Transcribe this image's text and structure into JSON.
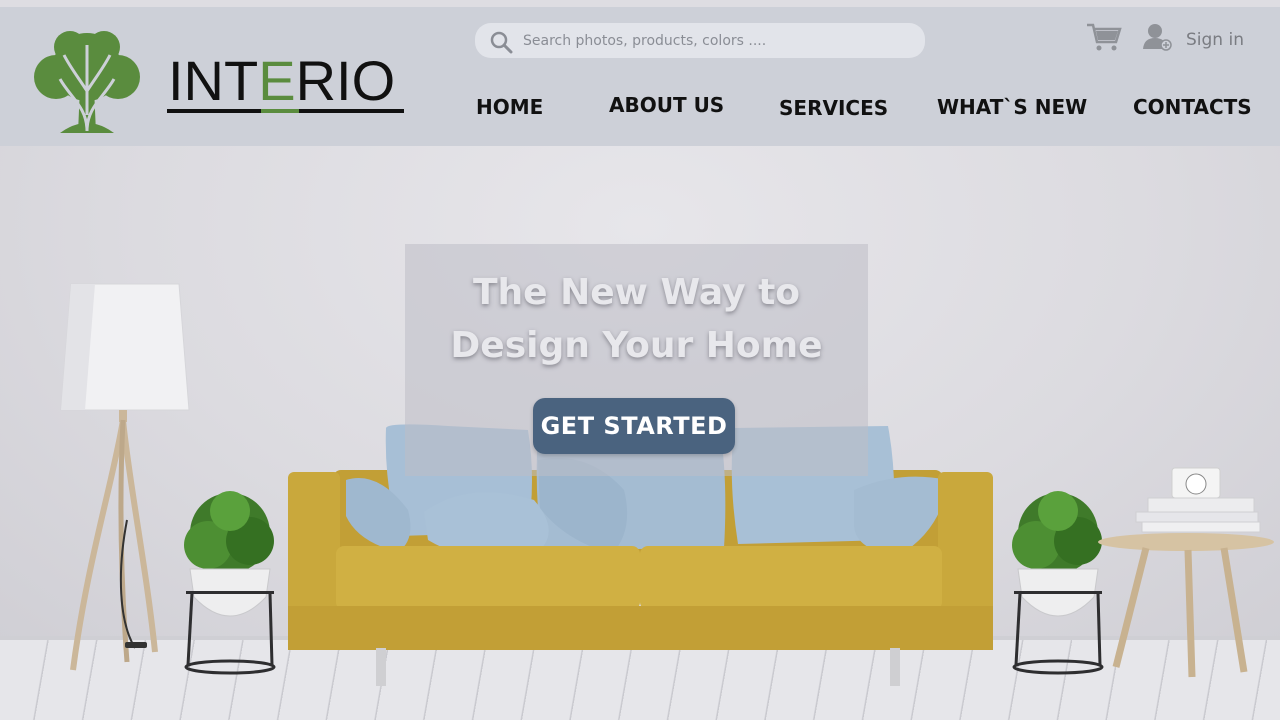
{
  "brand": {
    "name_prefix": "INT",
    "name_accent": "E",
    "name_suffix": "RIO",
    "accent_color": "#5a8c3e",
    "logo_icon": "tree-icon"
  },
  "header": {
    "search": {
      "placeholder": "Search photos, products, colors ....",
      "icon": "search-icon"
    },
    "cart_icon": "cart-icon",
    "user_icon": "user-add-icon",
    "signin_label": "Sign in"
  },
  "nav": {
    "items": [
      {
        "label": "HOME"
      },
      {
        "label": "ABOUT US"
      },
      {
        "label": "SERVICES"
      },
      {
        "label": "WHAT`S NEW"
      },
      {
        "label": "CONTACTS"
      }
    ]
  },
  "hero": {
    "title": "The New Way to Design Your Home",
    "cta_label": "GET STARTED",
    "cta_color": "#4a637f"
  },
  "colors": {
    "header_bg": "#cdd0d8",
    "sofa": "#c9a83c",
    "pillow": "#a9c0d6"
  }
}
